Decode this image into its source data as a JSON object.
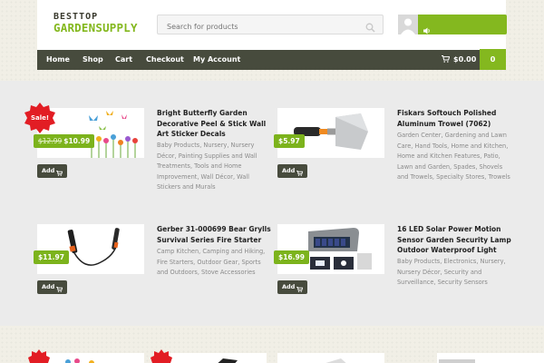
{
  "logo": {
    "top": "BESTTOP",
    "bottom": "GARDENSUPPLY"
  },
  "search": {
    "placeholder": "Search for products"
  },
  "nav": {
    "items": [
      "Home",
      "Shop",
      "Cart",
      "Checkout",
      "My Account"
    ],
    "cart_total": "$0.00",
    "cart_count": "0"
  },
  "colors": {
    "accent": "#84b81f",
    "nav_bg": "#474b3d",
    "sale": "#e21d24"
  },
  "sale_label": "Sale!",
  "add_label": "Add",
  "products": [
    {
      "title": "Bright Butterfly Garden Decorative Peel & Stick Wall Art Sticker Decals",
      "old_price": "$12.99",
      "price": "$10.99",
      "on_sale": true,
      "categories": "Baby Products, Nursery, Nursery Décor, Painting Supplies and Wall Treatments, Tools and Home Improvement, Wall Décor, Wall Stickers and Murals"
    },
    {
      "title": "Fiskars Softouch Polished Aluminum Trowel (7062)",
      "price": "$5.97",
      "on_sale": false,
      "categories": "Garden Center, Gardening and Lawn Care, Hand Tools, Home and Kitchen, Home and Kitchen Features, Patio, Lawn and Garden, Spades, Shovels and Trowels, Specialty Stores, Trowels"
    },
    {
      "title": "Gerber 31-000699 Bear Grylls Survival Series Fire Starter",
      "price": "$11.97",
      "on_sale": false,
      "categories": "Camp Kitchen, Camping and Hiking, Fire Starters, Outdoor Gear, Sports and Outdoors, Stove Accessories"
    },
    {
      "title": "16 LED Solar Power Motion Sensor Garden Security Lamp Outdoor Waterproof Light",
      "price": "$16.99",
      "on_sale": false,
      "categories": "Baby Products, Electronics, Nursery, Nursery Décor, Security and Surveillance, Security Sensors"
    }
  ]
}
